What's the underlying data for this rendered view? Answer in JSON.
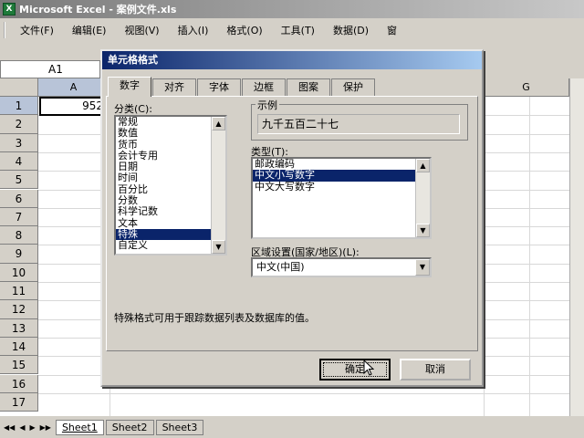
{
  "window": {
    "title": "Microsoft Excel - 案例文件.xls",
    "app_icon": "X"
  },
  "menu": {
    "items": [
      "文件(F)",
      "编辑(E)",
      "视图(V)",
      "插入(I)",
      "格式(O)",
      "工具(T)",
      "数据(D)",
      "窗"
    ]
  },
  "formula_bar": {
    "name_box": "A1"
  },
  "sheet": {
    "columns": [
      "A",
      "G"
    ],
    "rows": [
      "1",
      "2",
      "3",
      "4",
      "5",
      "6",
      "7",
      "8",
      "9",
      "10",
      "11",
      "12",
      "13",
      "14",
      "15",
      "16",
      "17"
    ],
    "cell_a1": "952"
  },
  "sheet_tabs": {
    "nav": [
      "◀◀",
      "◀",
      "▶",
      "▶▶"
    ],
    "tabs": [
      "Sheet1",
      "Sheet2",
      "Sheet3"
    ],
    "active": "Sheet1"
  },
  "dialog": {
    "title": "单元格格式",
    "tabs": [
      "数字",
      "对齐",
      "字体",
      "边框",
      "图案",
      "保护"
    ],
    "active_tab": "数字",
    "category_label": "分类(C):",
    "categories": [
      "常规",
      "数值",
      "货币",
      "会计专用",
      "日期",
      "时间",
      "百分比",
      "分数",
      "科学记数",
      "文本",
      "特殊",
      "自定义"
    ],
    "selected_category": "特殊",
    "sample_label": "示例",
    "sample_value": "九千五百二十七",
    "type_label": "类型(T):",
    "types": [
      "邮政编码",
      "中文小写数字",
      "中文大写数字"
    ],
    "selected_type": "中文小写数字",
    "locale_label": "区域设置(国家/地区)(L):",
    "locale_value": "中文(中国)",
    "description": "特殊格式可用于跟踪数据列表及数据库的值。",
    "ok_label": "确定",
    "cancel_label": "取消"
  },
  "colors": {
    "selection": "#0a246a",
    "dialog_bg": "#d4d0c8",
    "title_gradient_start": "#0a246a"
  }
}
